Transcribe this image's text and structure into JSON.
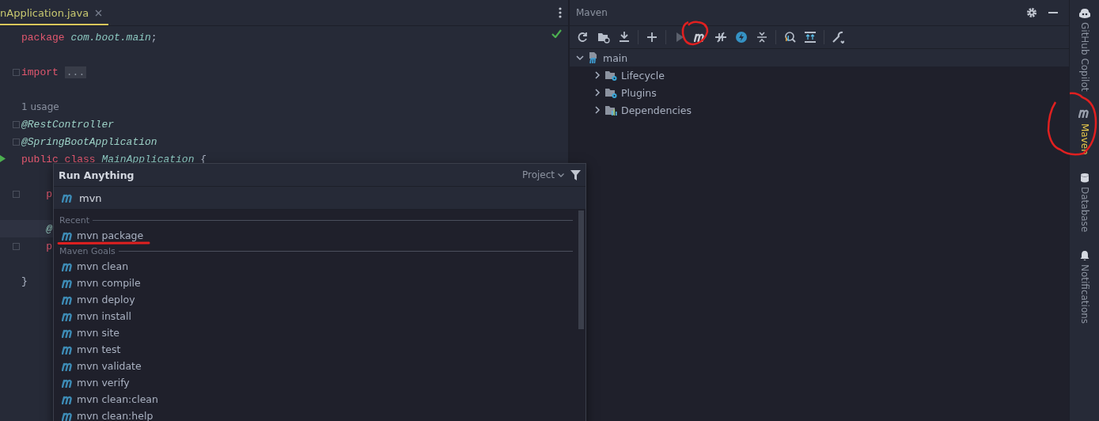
{
  "editor": {
    "tab": {
      "label": "nApplication.java",
      "selected": true
    },
    "lines": [
      {
        "kind": "code",
        "tokens": [
          {
            "t": "package",
            "kind": "kw"
          },
          {
            "t": " com.boot.main",
            "kind": "pkg"
          },
          {
            "t": ";",
            "kind": "plain"
          }
        ]
      },
      {
        "kind": "blank"
      },
      {
        "kind": "code",
        "fold": true,
        "tokens": [
          {
            "t": "import",
            "kind": "kw"
          },
          {
            "t": "...",
            "kind": "folded"
          }
        ]
      },
      {
        "kind": "blank"
      },
      {
        "kind": "hint",
        "text": "1 usage"
      },
      {
        "kind": "code",
        "fold": true,
        "tokens": [
          {
            "t": "@RestController",
            "kind": "ann"
          }
        ]
      },
      {
        "kind": "code",
        "fold": true,
        "tokens": [
          {
            "t": "@SpringBootApplication",
            "kind": "ann"
          }
        ]
      },
      {
        "kind": "code",
        "run": true,
        "tokens": [
          {
            "t": "public class ",
            "kind": "kw"
          },
          {
            "t": "MainApplication",
            "kind": "cls"
          },
          {
            "t": " {",
            "kind": "plain"
          }
        ]
      },
      {
        "kind": "blank"
      },
      {
        "kind": "code",
        "fold": true,
        "tokens": [
          {
            "t": "    p",
            "kind": "kw"
          }
        ]
      },
      {
        "kind": "blank"
      },
      {
        "kind": "code",
        "current": true,
        "tokens": [
          {
            "t": "    @",
            "kind": "ann"
          }
        ]
      },
      {
        "kind": "code",
        "fold": true,
        "tokens": [
          {
            "t": "    p",
            "kind": "kw"
          }
        ]
      },
      {
        "kind": "blank"
      },
      {
        "kind": "code",
        "tokens": [
          {
            "t": "}",
            "kind": "plain"
          }
        ]
      }
    ]
  },
  "maven": {
    "title": "Maven",
    "tree": [
      {
        "label": "main",
        "kind": "project",
        "expanded": true,
        "children": [
          {
            "label": "Lifecycle",
            "kind": "gear-folder",
            "expanded": false
          },
          {
            "label": "Plugins",
            "kind": "gear-folder",
            "expanded": false
          },
          {
            "label": "Dependencies",
            "kind": "deps",
            "expanded": false
          }
        ]
      }
    ]
  },
  "side_strip": [
    {
      "label": "GitHub Copilot",
      "kind": "copilot",
      "selected": false
    },
    {
      "label": "Maven",
      "kind": "maven",
      "selected": true
    },
    {
      "label": "Database",
      "kind": "database",
      "selected": false
    },
    {
      "label": "Notifications",
      "kind": "bell",
      "selected": false
    }
  ],
  "popup": {
    "title": "Run Anything",
    "scope": "Project",
    "query": "mvn",
    "sections": [
      {
        "title": "Recent",
        "items": [
          "mvn package"
        ]
      },
      {
        "title": "Maven Goals",
        "items": [
          "mvn clean",
          "mvn compile",
          "mvn deploy",
          "mvn install",
          "mvn site",
          "mvn test",
          "mvn validate",
          "mvn verify",
          "mvn clean:clean",
          "mvn clean:help"
        ]
      }
    ]
  }
}
